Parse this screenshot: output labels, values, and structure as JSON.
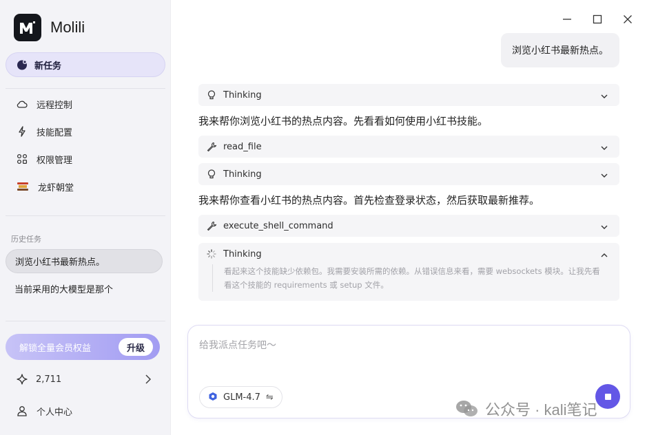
{
  "app": {
    "name": "Molili"
  },
  "sidebar": {
    "new_task": "新任务",
    "nav": [
      {
        "label": "远程控制",
        "icon": "cloud-icon"
      },
      {
        "label": "技能配置",
        "icon": "bolt-icon"
      },
      {
        "label": "权限管理",
        "icon": "apps-icon"
      },
      {
        "label": "龙虾朝堂",
        "icon": "lobster-icon"
      }
    ],
    "history_label": "历史任务",
    "history": [
      {
        "label": "浏览小红书最新热点。",
        "active": true
      },
      {
        "label": "当前采用的大模型是那个",
        "active": false
      }
    ],
    "upgrade": {
      "label": "解锁全量会员权益",
      "button": "升级"
    },
    "points": "2,711",
    "profile": "个人中心"
  },
  "chat": {
    "user_message": "浏览小红书最新热点。",
    "steps": [
      {
        "type": "thinking",
        "label": "Thinking"
      },
      {
        "type": "message",
        "text": "我来帮你浏览小红书的热点内容。先看看如何使用小红书技能。"
      },
      {
        "type": "tool",
        "label": "read_file"
      },
      {
        "type": "thinking",
        "label": "Thinking"
      },
      {
        "type": "message",
        "text": "我来帮你查看小红书的热点内容。首先检查登录状态，然后获取最新推荐。"
      },
      {
        "type": "tool",
        "label": "execute_shell_command"
      },
      {
        "type": "thinking_expanded",
        "label": "Thinking",
        "text_line1": "看起来这个技能缺少依赖包。我需要安装所需的依赖。从错误信息来看，需要 websockets 模块。让我先看",
        "text_line2": "看这个技能的 requirements 或 setup 文件。"
      }
    ]
  },
  "composer": {
    "placeholder": "给我派点任务吧～",
    "model": "GLM-4.7",
    "swap_symbol": "⇋"
  },
  "watermark": "公众号 · kali笔记",
  "colors": {
    "accent": "#6357e6",
    "sidebar_bg": "#f3f3f7",
    "step_bg": "#f5f5f7"
  }
}
